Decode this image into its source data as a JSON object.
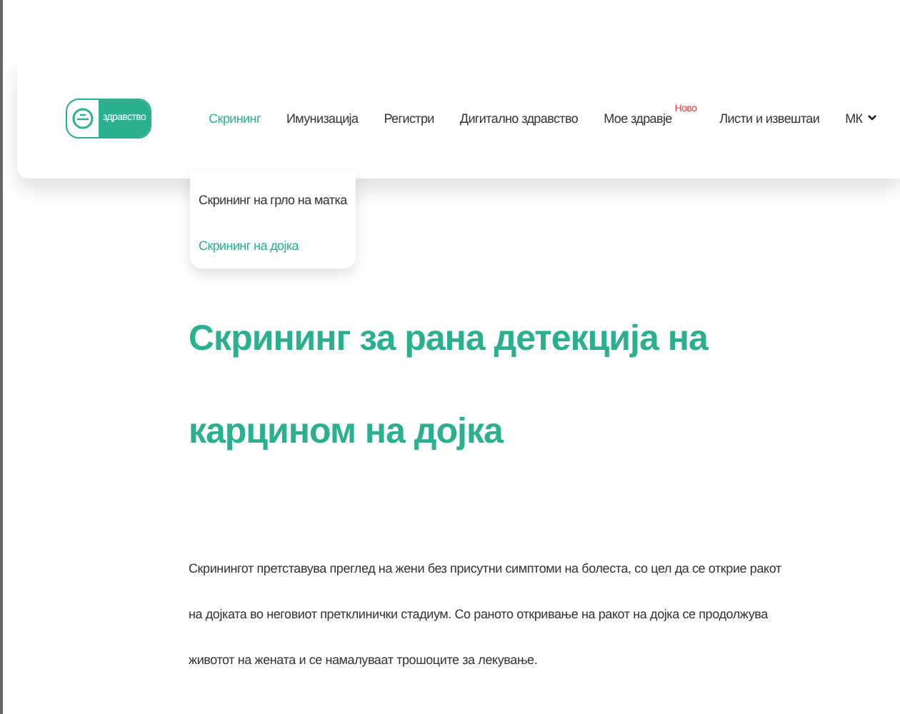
{
  "logo": {
    "text": "здравство"
  },
  "nav": [
    {
      "label": "Скрининг",
      "selected": true
    },
    {
      "label": "Имунизација",
      "selected": false
    },
    {
      "label": "Регистри",
      "selected": false
    },
    {
      "label": "Дигитално здравство",
      "selected": false
    },
    {
      "label": "Мое здравје",
      "selected": false,
      "badge": "Ново"
    },
    {
      "label": "Листи и извештаи",
      "selected": false
    },
    {
      "label": "МК",
      "selected": false,
      "kind": "dropdown"
    }
  ],
  "submenu": [
    {
      "label": "Скрининг на грло на матка",
      "selected": false
    },
    {
      "label": "Скрининг на дојка",
      "selected": true
    }
  ],
  "heading": "Скрининг за рана детекција на карцином на дојка",
  "paragraph": "Скринингот претставува преглед на жени без присутни симптоми на болеста, со цел да се открие ракот на дојката во неговиот претклинички стадиум. Со раното откривање на ракот на дојка се продолжува животот на жената и се намалуваат трошоците за лекување."
}
